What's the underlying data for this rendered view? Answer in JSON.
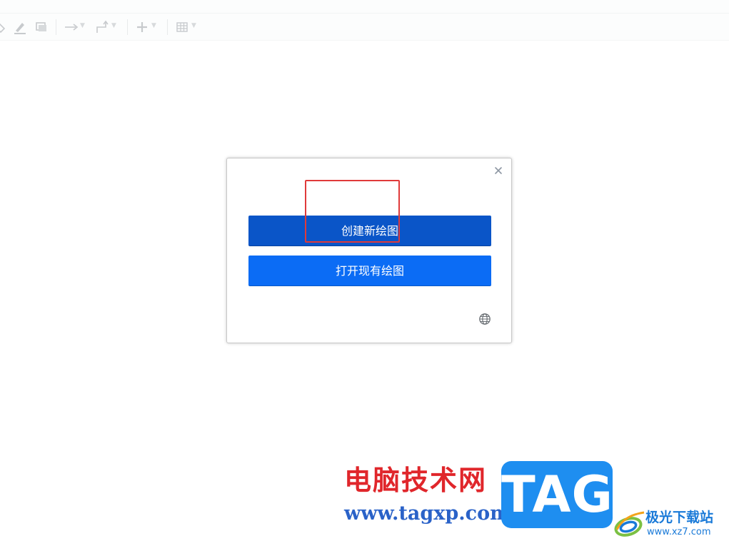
{
  "dialog": {
    "create_label": "创建新绘图",
    "open_label": "打开现有绘图",
    "close_label": "×"
  },
  "watermark": {
    "site_name": "电脑技术网",
    "site_url": "www.tagxp.com",
    "tag_text": "TAG",
    "brand_name": "极光下载站",
    "brand_url": "www.xz7.com"
  },
  "colors": {
    "create_button": "#0a55c8",
    "open_button": "#0b6cf5",
    "highlight": "#e03a3a",
    "watermark_red": "#e0262b",
    "watermark_blue": "#2a62c8",
    "tag_blue": "#1e8ef0"
  },
  "icons": {
    "toolbar": [
      "fill-color-icon",
      "line-color-icon",
      "shadow-icon",
      "connection-arrow-icon",
      "waypoints-icon",
      "insert-plus-icon",
      "table-icon"
    ],
    "dialog": [
      "close-icon",
      "globe-icon"
    ]
  }
}
